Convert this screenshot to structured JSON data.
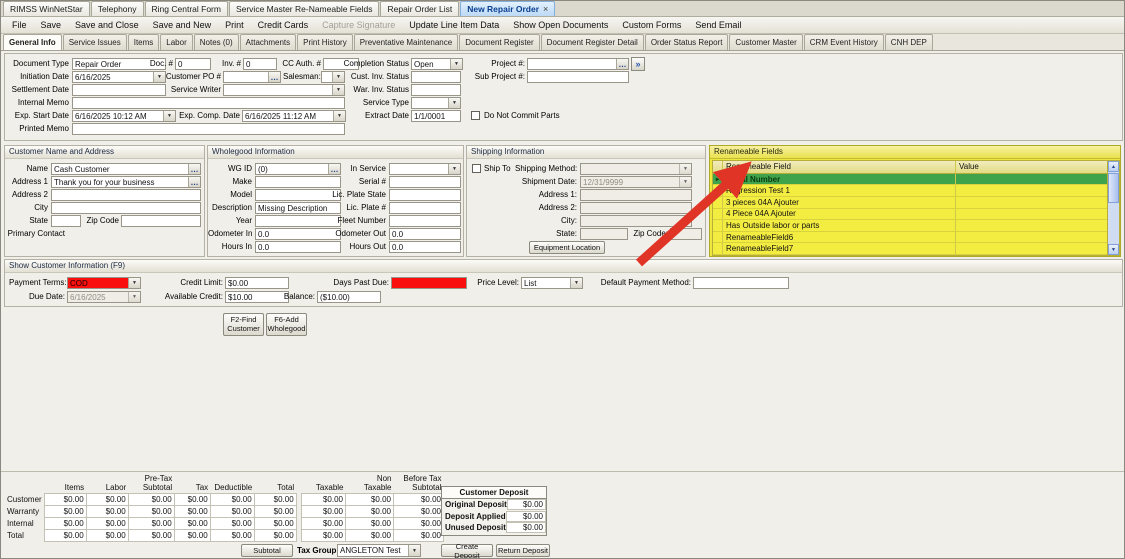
{
  "colors": {
    "highlight_yellow": "#eee73e",
    "selected_row_green": "#3fa34b",
    "alert_red": "#fa0f0f",
    "active_tab_blue": "#bcd9f6",
    "annotation_arrow_red": "#e03226"
  },
  "icons": {
    "chevron_down": "▼",
    "ellipsis": "…",
    "scroll_up": "▲",
    "scroll_down": "▼",
    "row_marker": "▸",
    "project_lookup": "»",
    "close": "×"
  },
  "doc_tabs": {
    "items": [
      {
        "label": "RIMSS WinNetStar"
      },
      {
        "label": "Telephony"
      },
      {
        "label": "Ring Central Form"
      },
      {
        "label": "Service Master Re-Nameable Fields"
      },
      {
        "label": "Repair Order List"
      },
      {
        "label": "New Repair Order"
      }
    ]
  },
  "menubar": {
    "items": [
      {
        "label": "File"
      },
      {
        "label": "Save"
      },
      {
        "label": "Save and Close"
      },
      {
        "label": "Save and New"
      },
      {
        "label": "Print"
      },
      {
        "label": "Credit Cards"
      },
      {
        "label": "Capture Signature"
      },
      {
        "label": "Update Line Item Data"
      },
      {
        "label": "Show Open Documents"
      },
      {
        "label": "Custom Forms"
      },
      {
        "label": "Send Email"
      }
    ]
  },
  "page_tabs": {
    "items": [
      "General Info",
      "Service Issues",
      "Items",
      "Labor",
      "Notes (0)",
      "Attachments",
      "Print History",
      "Preventative Maintenance",
      "Document Register",
      "Document Register Detail",
      "Order Status Report",
      "Customer Master",
      "CRM Event History",
      "CNH DEP"
    ]
  },
  "header_form": {
    "document_type": {
      "label": "Document Type",
      "value": "Repair Order"
    },
    "doc_no": {
      "label": "Doc. #",
      "value": "0"
    },
    "inv_no": {
      "label": "Inv. #",
      "value": "0"
    },
    "cc_auth": {
      "label": "CC Auth. #",
      "value": ""
    },
    "completion_status": {
      "label": "Completion Status",
      "value": "Open"
    },
    "project_no": {
      "label": "Project #:",
      "value": ""
    },
    "initiation_date": {
      "label": "Initiation Date",
      "value": "6/16/2025"
    },
    "customer_po": {
      "label": "Customer PO #",
      "value": ""
    },
    "salesman": {
      "label": "Salesman:",
      "value": ""
    },
    "cust_inv_status": {
      "label": "Cust. Inv. Status",
      "value": ""
    },
    "sub_project_no": {
      "label": "Sub Project #:",
      "value": ""
    },
    "settlement_date": {
      "label": "Settlement Date",
      "value": ""
    },
    "service_writer": {
      "label": "Service Writer",
      "value": ""
    },
    "war_inv_status": {
      "label": "War. Inv. Status",
      "value": ""
    },
    "internal_memo": {
      "label": "Internal Memo",
      "value": ""
    },
    "service_type": {
      "label": "Service Type",
      "value": ""
    },
    "exp_start_date": {
      "label": "Exp. Start Date",
      "value": "6/16/2025 10:12 AM"
    },
    "exp_comp_date": {
      "label": "Exp. Comp. Date",
      "value": "6/16/2025 11:12 AM"
    },
    "extract_date": {
      "label": "Extract Date",
      "value": "1/1/0001"
    },
    "do_not_commit_parts": {
      "label": "Do Not Commit Parts",
      "checked": false
    },
    "printed_memo": {
      "label": "Printed Memo",
      "value": ""
    }
  },
  "customer_section": {
    "title": "Customer Name and Address",
    "name": {
      "label": "Name",
      "value": "Cash Customer"
    },
    "address1": {
      "label": "Address 1",
      "value": "Thank you for your business"
    },
    "address2": {
      "label": "Address 2",
      "value": ""
    },
    "city": {
      "label": "City",
      "value": ""
    },
    "state": {
      "label": "State",
      "value": ""
    },
    "zip": {
      "label": "Zip Code",
      "value": ""
    },
    "primary_contact": {
      "label": "Primary Contact",
      "value": ""
    }
  },
  "wholegood_section": {
    "title": "Wholegood Information",
    "wg_id": {
      "label": "WG ID",
      "value": "(0)"
    },
    "make": {
      "label": "Make",
      "value": ""
    },
    "model": {
      "label": "Model",
      "value": ""
    },
    "description": {
      "label": "Description",
      "value": "Missing Description"
    },
    "year": {
      "label": "Year",
      "value": ""
    },
    "odometer_in": {
      "label": "Odometer In",
      "value": "0.0"
    },
    "hours_in": {
      "label": "Hours In",
      "value": "0.0"
    },
    "in_service": {
      "label": "In Service",
      "value": ""
    },
    "serial_no": {
      "label": "Serial #",
      "value": ""
    },
    "lic_plate_state": {
      "label": "Lic. Plate State",
      "value": ""
    },
    "lic_plate_no": {
      "label": "Lic. Plate #",
      "value": ""
    },
    "fleet_number": {
      "label": "Fleet Number",
      "value": ""
    },
    "odometer_out": {
      "label": "Odometer Out",
      "value": "0.0"
    },
    "hours_out": {
      "label": "Hours Out",
      "value": "0.0"
    }
  },
  "shipping_section": {
    "title": "Shipping Information",
    "ship_to": {
      "label": "Ship To",
      "checked": false
    },
    "shipping_method": {
      "label": "Shipping Method:",
      "value": ""
    },
    "shipment_date": {
      "label": "Shipment Date:",
      "value": "12/31/9999"
    },
    "address1": {
      "label": "Address 1:",
      "value": ""
    },
    "address2": {
      "label": "Address 2:",
      "value": ""
    },
    "city": {
      "label": "City:",
      "value": ""
    },
    "state": {
      "label": "State:",
      "value": ""
    },
    "zip": {
      "label": "Zip Code:",
      "value": ""
    },
    "equipment_location_button": "Equipment Location"
  },
  "renameable_section": {
    "title": "Renameable Fields",
    "columns": [
      "Renameable Field",
      "Value"
    ],
    "rows": [
      {
        "field": "Serial Number",
        "value": "",
        "selected": true
      },
      {
        "field": "Regression Test 1",
        "value": ""
      },
      {
        "field": "3 pieces 04A Ajouter",
        "value": ""
      },
      {
        "field": "4 Piece 04A Ajouter",
        "value": ""
      },
      {
        "field": "Has Outside labor or parts",
        "value": ""
      },
      {
        "field": "RenameableField6",
        "value": ""
      },
      {
        "field": "RenameableField7",
        "value": ""
      }
    ]
  },
  "customer_info_section": {
    "title": "Show Customer Information (F9)",
    "payment_terms": {
      "label": "Payment Terms:",
      "value": "COD"
    },
    "credit_limit": {
      "label": "Credit Limit:",
      "value": "$0.00"
    },
    "days_past_due": {
      "label": "Days Past Due:",
      "value": ""
    },
    "price_level": {
      "label": "Price Level:",
      "value": "List"
    },
    "default_payment_method": {
      "label": "Default Payment Method:",
      "value": ""
    },
    "due_date": {
      "label": "Due Date:",
      "value": "6/16/2025"
    },
    "available_credit": {
      "label": "Available Credit:",
      "value": "$10.00"
    },
    "balance": {
      "label": "Balance:",
      "value": "($10.00)"
    }
  },
  "actions": {
    "find_customer": {
      "line1": "F2-Find",
      "line2": "Customer"
    },
    "add_wholegood": {
      "line1": "F6-Add",
      "line2": "Wholegood"
    },
    "subtotal": "Subtotal",
    "create_deposit": "Create Deposit",
    "return_deposit": "Return Deposit"
  },
  "totals": {
    "row_headers": [
      "Customer",
      "Warranty",
      "Internal",
      "Total"
    ],
    "col_headers": [
      "Items",
      "Labor",
      "Pre-Tax Subtotal",
      "Tax",
      "Deductible",
      "Total"
    ],
    "values": [
      [
        "$0.00",
        "$0.00",
        "$0.00",
        "$0.00",
        "$0.00",
        "$0.00"
      ],
      [
        "$0.00",
        "$0.00",
        "$0.00",
        "$0.00",
        "$0.00",
        "$0.00"
      ],
      [
        "$0.00",
        "$0.00",
        "$0.00",
        "$0.00",
        "$0.00",
        "$0.00"
      ],
      [
        "$0.00",
        "$0.00",
        "$0.00",
        "$0.00",
        "$0.00",
        "$0.00"
      ]
    ],
    "tax_col_headers": [
      "Taxable",
      "Non Taxable",
      "Before Tax Subtotal"
    ],
    "tax_values": [
      [
        "$0.00",
        "$0.00",
        "$0.00"
      ],
      [
        "$0.00",
        "$0.00",
        "$0.00"
      ],
      [
        "$0.00",
        "$0.00",
        "$0.00"
      ],
      [
        "$0.00",
        "$0.00",
        "$0.00"
      ]
    ],
    "tax_group": {
      "label": "Tax Group",
      "value": "ANGLETON Test"
    }
  },
  "deposit": {
    "title": "Customer Deposit",
    "rows": [
      {
        "label": "Original Deposit",
        "value": "$0.00"
      },
      {
        "label": "Deposit Applied",
        "value": "$0.00"
      },
      {
        "label": "Unused Deposit",
        "value": "$0.00"
      }
    ]
  }
}
